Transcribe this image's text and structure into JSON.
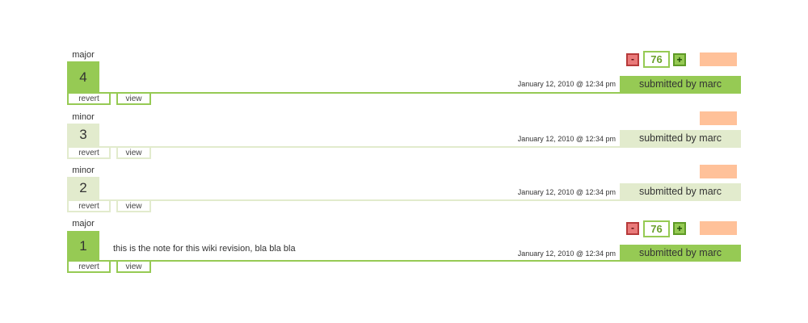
{
  "revisions": [
    {
      "type": "major",
      "number": "4",
      "note": "",
      "date": "January 12, 2010 @ 12:34 pm",
      "submitted": "submitted by marc",
      "revert": "revert",
      "view": "view",
      "score": "76",
      "minus": "-",
      "plus": "+"
    },
    {
      "type": "minor",
      "number": "3",
      "note": "",
      "date": "January 12, 2010 @ 12:34 pm",
      "submitted": "submitted by marc",
      "revert": "revert",
      "view": "view"
    },
    {
      "type": "minor",
      "number": "2",
      "note": "",
      "date": "January 12, 2010 @ 12:34 pm",
      "submitted": "submitted by marc",
      "revert": "revert",
      "view": "view"
    },
    {
      "type": "major",
      "number": "1",
      "note": "this is the note for this wiki revision, bla bla bla",
      "date": "January 12, 2010 @ 12:34 pm",
      "submitted": "submitted by marc",
      "revert": "revert",
      "view": "view",
      "score": "76",
      "minus": "-",
      "plus": "+"
    }
  ],
  "colors": {
    "major": "#96ca54",
    "minor": "#e2ebcd",
    "peach": "#ffc199",
    "minus": "#e97a7a"
  }
}
